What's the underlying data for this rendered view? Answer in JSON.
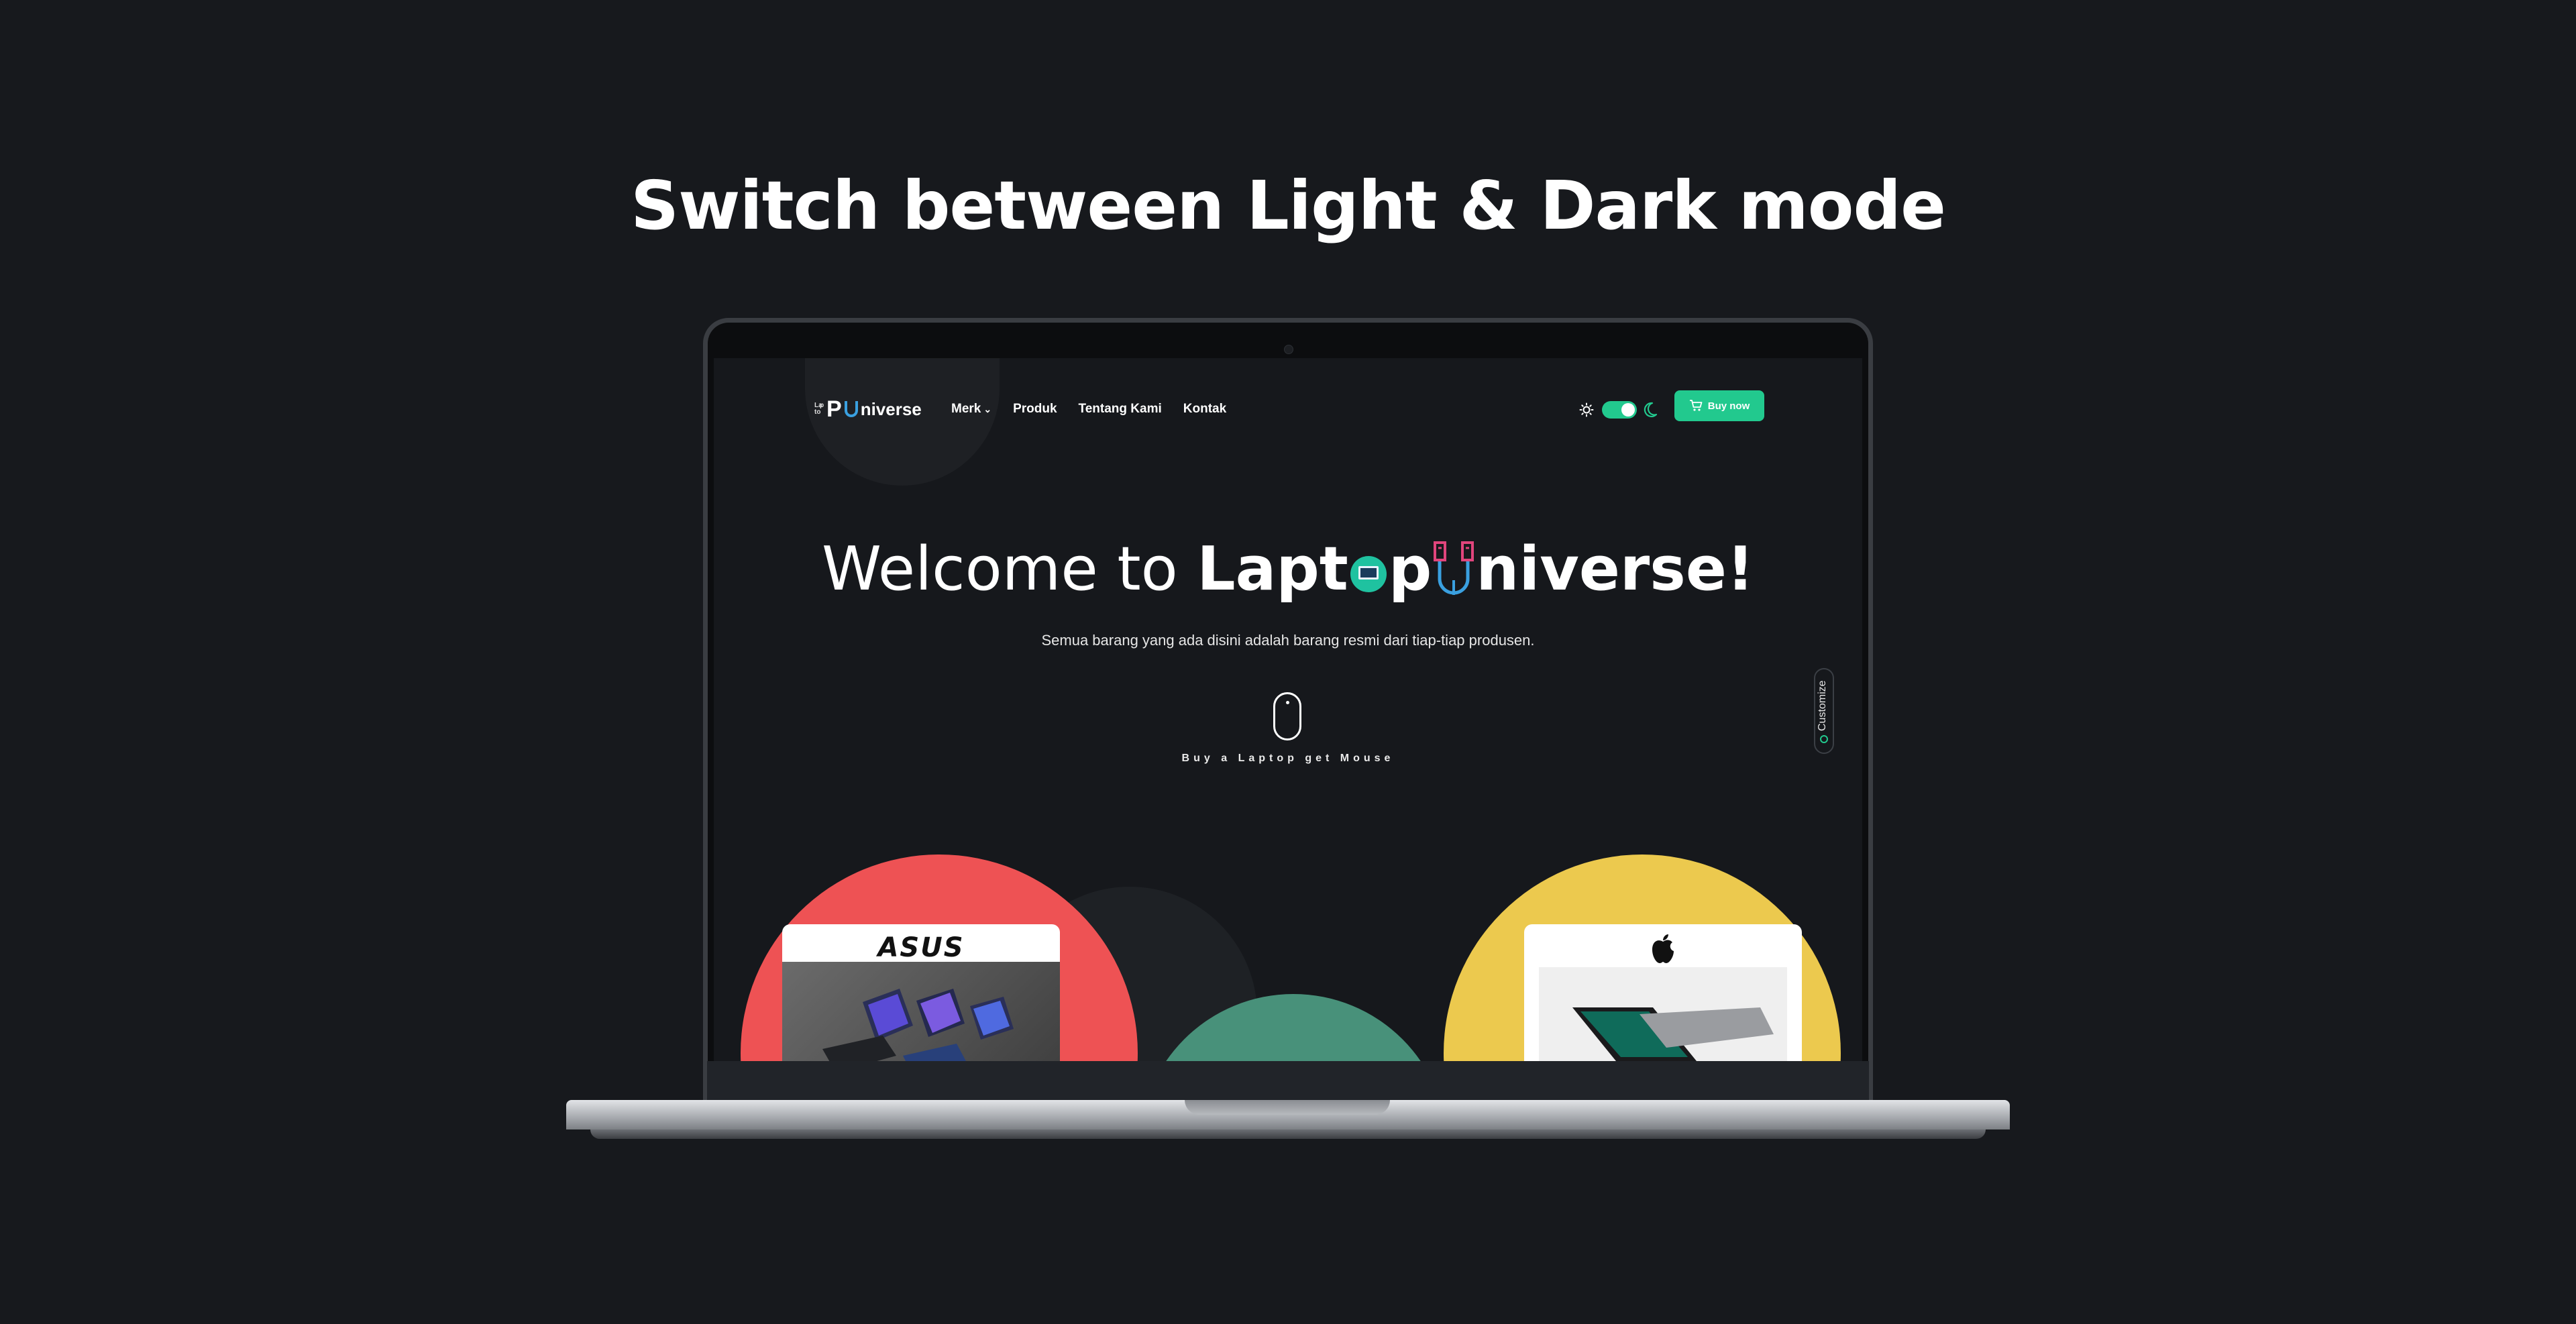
{
  "headline": "Switch between Light & Dark mode",
  "site": {
    "logo": {
      "mini": [
        "La",
        "p",
        "to",
        ""
      ],
      "p": "P",
      "text": "niverse"
    },
    "nav": [
      {
        "label": "Merk",
        "active": true,
        "has_dropdown": true
      },
      {
        "label": "Produk",
        "active": false
      },
      {
        "label": "Tentang Kami",
        "active": false
      },
      {
        "label": "Kontak",
        "active": false
      }
    ],
    "theme_toggle": {
      "mode": "dark"
    },
    "buy_button": {
      "label": "Buy now",
      "icon": "cart-icon"
    },
    "hero": {
      "title_thin": "Welcome to ",
      "title_bold_1": "Lapt",
      "title_bold_2": "p",
      "title_bold_3": "niverse!",
      "subtitle": "Semua barang yang ada disini adalah barang resmi dari tiap-tiap produsen.",
      "promo": "Buy a Laptop get Mouse"
    },
    "customize": {
      "label": "Customize"
    },
    "brands": [
      {
        "name": "ASUS",
        "color": "#ee5254"
      },
      {
        "name": "Apple",
        "color": "#ecc94e"
      }
    ],
    "colors": {
      "accent": "#22c98e",
      "background": "#16181c",
      "green_circle": "#48917a"
    }
  }
}
